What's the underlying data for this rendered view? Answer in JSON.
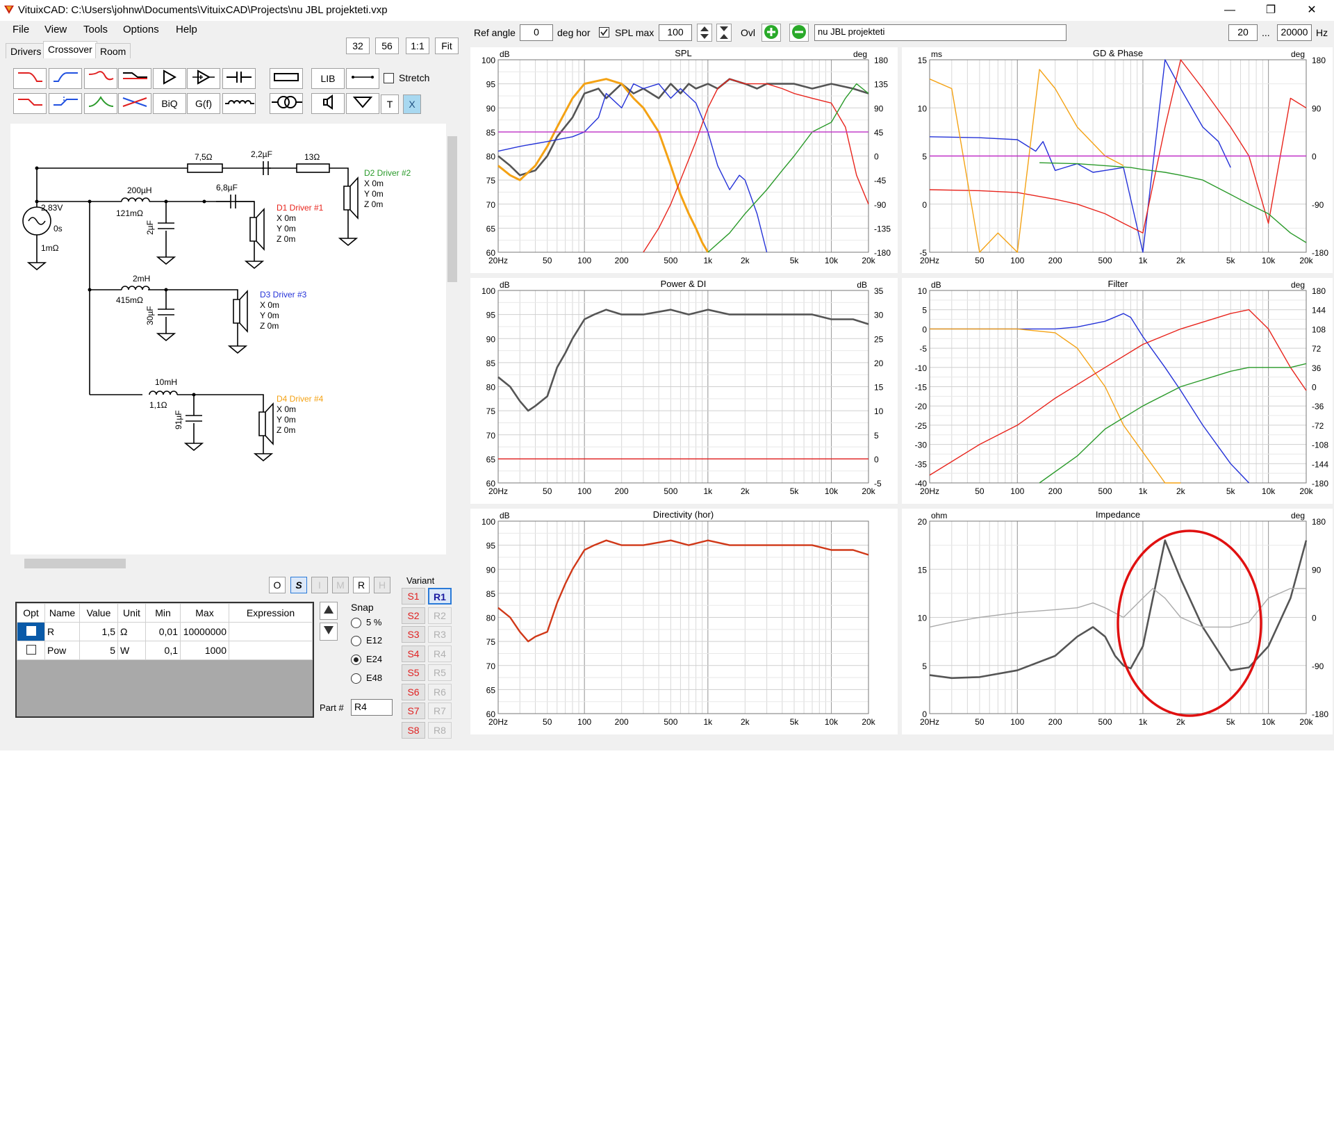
{
  "window": {
    "title": "VituixCAD: C:\\Users\\johnw\\Documents\\VituixCAD\\Projects\\nu JBL projekteti.vxp",
    "minimize": "—",
    "restore": "❐",
    "close": "✕"
  },
  "menu": [
    "File",
    "View",
    "Tools",
    "Options",
    "Help"
  ],
  "tabs": [
    "Drivers",
    "Crossover",
    "Room"
  ],
  "zoom": {
    "v1": "32",
    "v2": "56",
    "one": "1:1",
    "fit": "Fit"
  },
  "toolbar": {
    "lib": "LIB",
    "biq": "BiQ",
    "gf": "G(f)",
    "t": "T",
    "x": "X",
    "stretch": "Stretch"
  },
  "schematic": {
    "source_v": "2,83V",
    "source_phase": "0s",
    "source_r": "1mΩ",
    "r1": "7,5Ω",
    "c1": "2,2µF",
    "r2": "13Ω",
    "l1": "200µH",
    "l1r": "121mΩ",
    "c2": "6,8µF",
    "c3": "2µF",
    "l2": "2mH",
    "l2r": "415mΩ",
    "c4": "30µF",
    "l3": "10mH",
    "l3r": "1,1Ω",
    "c5": "91µF",
    "d1": "D1 Driver #1",
    "d2": "D2 Driver #2",
    "d3": "D3 Driver #3",
    "d4": "D4 Driver #4",
    "pos": [
      "X 0m",
      "Y 0m",
      "Z 0m"
    ],
    "colors": {
      "d1": "#e8241c",
      "d2": "#2a9a2a",
      "d3": "#2432d8",
      "d4": "#f4a214"
    }
  },
  "mode_buttons": [
    "O",
    "S",
    "I",
    "M",
    "R",
    "H"
  ],
  "params": {
    "headers": [
      "Opt",
      "Name",
      "Value",
      "Unit",
      "Min",
      "Max",
      "Expression"
    ],
    "rows": [
      [
        "",
        "R",
        "1,5",
        "Ω",
        "0,01",
        "10000000",
        ""
      ],
      [
        "",
        "Pow",
        "5",
        "W",
        "0,1",
        "1000",
        ""
      ]
    ]
  },
  "snap": {
    "label": "Snap",
    "options": [
      "5 %",
      "E12",
      "E24",
      "E48"
    ],
    "selected": "E24"
  },
  "part": {
    "label": "Part #",
    "value": "R4"
  },
  "variant": {
    "label": "Variant",
    "s": [
      "S1",
      "S2",
      "S3",
      "S4",
      "S5",
      "S6",
      "S7",
      "S8"
    ],
    "r": [
      "R1",
      "R2",
      "R3",
      "R4",
      "R5",
      "R6",
      "R7",
      "R8"
    ],
    "active": "R1"
  },
  "topbar": {
    "ref_angle_label": "Ref angle",
    "ref_angle_value": "0",
    "deg_hor": "deg hor",
    "spl_max_label": "SPL max",
    "spl_max_value": "100",
    "ovl": "Ovl",
    "project": "nu JBL projekteti",
    "freq_min": "20",
    "ellipsis": "...",
    "freq_max": "20000",
    "hz": "Hz"
  },
  "freq_ticks": [
    "20Hz",
    "50",
    "100",
    "200",
    "500",
    "1k",
    "2k",
    "5k",
    "10k",
    "20k"
  ],
  "chart_data": [
    {
      "type": "line",
      "title": "SPL",
      "ylabel_left": "dB",
      "ylabel_right": "deg",
      "ylim": [
        60,
        100
      ],
      "ylim_right": [
        -180,
        180
      ],
      "yticks_left": [
        "100",
        "95",
        "90",
        "85",
        "80",
        "75",
        "70",
        "65",
        "60"
      ],
      "yticks_right": [
        "180",
        "135",
        "90",
        "45",
        "0",
        "-45",
        "-90",
        "-135",
        "-180"
      ],
      "series": [
        {
          "color": "#555555",
          "x": [
            20,
            25,
            30,
            40,
            50,
            60,
            80,
            100,
            130,
            150,
            200,
            250,
            300,
            400,
            500,
            600,
            700,
            800,
            1000,
            1200,
            1500,
            2000,
            2500,
            3000,
            4000,
            5000,
            7000,
            10000,
            15000,
            20000
          ],
          "y": [
            80,
            78,
            76,
            77,
            80,
            84,
            88,
            93,
            94,
            92,
            95,
            93,
            94,
            92,
            95,
            93,
            95,
            94,
            95,
            94,
            96,
            95,
            94,
            95,
            95,
            95,
            94,
            95,
            94,
            93
          ]
        },
        {
          "color": "#f4a214",
          "x": [
            20,
            25,
            30,
            40,
            50,
            60,
            80,
            100,
            150,
            200,
            250,
            300,
            400,
            500,
            600,
            700,
            800,
            900,
            1000
          ],
          "y": [
            78,
            76,
            75,
            78,
            82,
            86,
            92,
            95,
            96,
            95,
            92,
            90,
            85,
            78,
            72,
            68,
            65,
            62,
            60
          ]
        },
        {
          "color": "#2432d8",
          "x": [
            20,
            30,
            50,
            80,
            100,
            130,
            150,
            200,
            250,
            300,
            400,
            500,
            600,
            800,
            1000,
            1200,
            1500,
            1800,
            2000,
            2500,
            3000
          ],
          "y": [
            81,
            82,
            83,
            84,
            85,
            88,
            93,
            90,
            95,
            94,
            95,
            92,
            94,
            91,
            85,
            78,
            73,
            76,
            75,
            68,
            60
          ]
        },
        {
          "color": "#e8241c",
          "x": [
            300,
            400,
            500,
            600,
            800,
            1000,
            1200,
            1500,
            2000,
            3000,
            4000,
            5000,
            7000,
            10000,
            13000,
            16000,
            20000
          ],
          "y": [
            60,
            65,
            70,
            75,
            83,
            90,
            94,
            96,
            95,
            95,
            94,
            93,
            92,
            91,
            86,
            76,
            70
          ]
        },
        {
          "color": "#2a9a2a",
          "x": [
            1000,
            1500,
            2000,
            3000,
            4000,
            5000,
            7000,
            10000,
            13000,
            16000,
            20000
          ],
          "y": [
            60,
            64,
            68,
            73,
            77,
            80,
            85,
            87,
            92,
            95,
            93
          ]
        },
        {
          "color": "#c030c8",
          "x": [
            20,
            20000
          ],
          "y": [
            85,
            85
          ]
        }
      ]
    },
    {
      "type": "line",
      "title": "GD & Phase",
      "ylabel_left": "ms",
      "ylabel_right": "deg",
      "ylim": [
        -5,
        15
      ],
      "ylim_right": [
        -180,
        180
      ],
      "yticks_left": [
        "15",
        "10",
        "5",
        "0",
        "-5"
      ],
      "yticks_right": [
        "180",
        "90",
        "0",
        "-90",
        "-180"
      ],
      "series": [
        {
          "color": "#2432d8",
          "x": [
            20,
            50,
            100,
            140,
            160,
            200,
            300,
            400,
            500,
            700,
            1000,
            1500,
            2000,
            3000,
            4000,
            5000
          ],
          "y": [
            7,
            6.9,
            6.7,
            5.5,
            6.5,
            3.5,
            4.2,
            3.3,
            3.5,
            3.8,
            -5,
            15,
            12,
            8,
            6.5,
            3.8
          ]
        },
        {
          "color": "#e8241c",
          "x": [
            20,
            50,
            100,
            200,
            300,
            500,
            700,
            1000,
            1500,
            2000,
            3000,
            5000,
            7000,
            10000,
            15000,
            20000
          ],
          "y": [
            1.5,
            1.4,
            1.2,
            0.5,
            0,
            -1,
            -2,
            -3,
            8,
            15,
            12,
            8,
            5,
            -2,
            11,
            10
          ]
        },
        {
          "color": "#2a9a2a",
          "x": [
            150,
            300,
            500,
            800,
            1000,
            1500,
            2000,
            3000,
            5000,
            7000,
            10000,
            15000,
            20000
          ],
          "y": [
            4.3,
            4.2,
            4,
            3.8,
            3.6,
            3.3,
            3,
            2.5,
            1,
            0,
            -1,
            -3,
            -4
          ]
        },
        {
          "color": "#f4a214",
          "x": [
            20,
            30,
            50,
            70,
            100,
            150,
            200,
            300,
            500,
            700
          ],
          "y": [
            13,
            12,
            -5,
            -3,
            -5,
            14,
            12,
            8,
            5,
            4
          ]
        },
        {
          "color": "#c030c8",
          "x": [
            20,
            20000
          ],
          "y": [
            5,
            5
          ]
        }
      ]
    },
    {
      "type": "line",
      "title": "Power & DI",
      "ylabel_left": "dB",
      "ylabel_right": "dB",
      "ylim": [
        60,
        100
      ],
      "ylim_right": [
        -5,
        35
      ],
      "yticks_left": [
        "100",
        "95",
        "90",
        "85",
        "80",
        "75",
        "70",
        "65",
        "60"
      ],
      "yticks_right": [
        "35",
        "30",
        "25",
        "20",
        "15",
        "10",
        "5",
        "0",
        "-5"
      ],
      "series": [
        {
          "color": "#555555",
          "x": [
            20,
            25,
            30,
            35,
            40,
            50,
            60,
            70,
            80,
            100,
            120,
            150,
            200,
            300,
            500,
            700,
            1000,
            1500,
            2000,
            3000,
            5000,
            7000,
            10000,
            15000,
            20000
          ],
          "y": [
            82,
            80,
            77,
            75,
            76,
            78,
            84,
            87,
            90,
            94,
            95,
            96,
            95,
            95,
            96,
            95,
            96,
            95,
            95,
            95,
            95,
            95,
            94,
            94,
            93
          ]
        },
        {
          "color": "#e01818",
          "x": [
            20,
            20000
          ],
          "y": [
            65,
            65
          ]
        }
      ]
    },
    {
      "type": "line",
      "title": "Filter",
      "ylabel_left": "dB",
      "ylabel_right": "deg",
      "ylim": [
        -40,
        10
      ],
      "ylim_right": [
        -180,
        180
      ],
      "yticks_left": [
        "10",
        "5",
        "0",
        "-5",
        "-10",
        "-15",
        "-20",
        "-25",
        "-30",
        "-35",
        "-40"
      ],
      "yticks_right": [
        "180",
        "144",
        "108",
        "72",
        "36",
        "0",
        "-36",
        "-72",
        "-108",
        "-144",
        "-180"
      ],
      "series": [
        {
          "color": "#2432d8",
          "x": [
            20,
            100,
            200,
            300,
            500,
            700,
            800,
            1000,
            1500,
            2000,
            3000,
            5000,
            7000
          ],
          "y": [
            0,
            0,
            0,
            0.5,
            2,
            4,
            3,
            -2,
            -10,
            -16,
            -25,
            -35,
            -40
          ]
        },
        {
          "color": "#f4a214",
          "x": [
            20,
            100,
            200,
            300,
            500,
            700,
            1000,
            1500,
            2000
          ],
          "y": [
            0,
            0,
            -1,
            -5,
            -15,
            -25,
            -32,
            -40,
            -40
          ]
        },
        {
          "color": "#e8241c",
          "x": [
            20,
            50,
            100,
            200,
            500,
            1000,
            2000,
            5000,
            7000,
            10000,
            15000,
            20000
          ],
          "y": [
            -38,
            -30,
            -25,
            -18,
            -10,
            -4,
            0,
            4,
            5,
            0,
            -10,
            -16
          ]
        },
        {
          "color": "#2a9a2a",
          "x": [
            150,
            300,
            500,
            1000,
            2000,
            5000,
            7000,
            10000,
            15000,
            20000
          ],
          "y": [
            -40,
            -33,
            -26,
            -20,
            -15,
            -11,
            -10,
            -10,
            -10,
            -9
          ]
        }
      ]
    },
    {
      "type": "line",
      "title": "Directivity (hor)",
      "ylabel_left": "dB",
      "ylim": [
        60,
        100
      ],
      "yticks_left": [
        "100",
        "95",
        "90",
        "85",
        "80",
        "75",
        "70",
        "65",
        "60"
      ],
      "series": [
        {
          "color": "#d03818",
          "x": [
            20,
            25,
            30,
            35,
            40,
            50,
            60,
            70,
            80,
            100,
            120,
            150,
            200,
            300,
            500,
            700,
            1000,
            1500,
            2000,
            3000,
            5000,
            7000,
            10000,
            15000,
            20000
          ],
          "y": [
            82,
            80,
            77,
            75,
            76,
            77,
            83,
            87,
            90,
            94,
            95,
            96,
            95,
            95,
            96,
            95,
            96,
            95,
            95,
            95,
            95,
            95,
            94,
            94,
            93
          ]
        }
      ]
    },
    {
      "type": "line",
      "title": "Impedance",
      "ylabel_left": "ohm",
      "ylabel_right": "deg",
      "ylim": [
        0,
        20
      ],
      "ylim_right": [
        -180,
        180
      ],
      "yticks_left": [
        "20",
        "15",
        "10",
        "5",
        "0"
      ],
      "yticks_right": [
        "180",
        "90",
        "0",
        "-90",
        "-180"
      ],
      "series": [
        {
          "color": "#555555",
          "x": [
            20,
            30,
            50,
            100,
            200,
            300,
            400,
            500,
            600,
            700,
            800,
            1000,
            1200,
            1500,
            2000,
            3000,
            5000,
            7000,
            10000,
            15000,
            20000
          ],
          "y": [
            4,
            3.7,
            3.8,
            4.5,
            6,
            8,
            9,
            8,
            6,
            5,
            4.7,
            7,
            12,
            18,
            14,
            9,
            4.5,
            4.8,
            7,
            12,
            18
          ]
        },
        {
          "color": "#aaaaaa",
          "x": [
            20,
            30,
            50,
            100,
            200,
            300,
            400,
            500,
            700,
            1000,
            1200,
            1500,
            2000,
            3000,
            5000,
            7000,
            10000,
            15000,
            20000
          ],
          "y": [
            9,
            9.5,
            10,
            10.5,
            10.8,
            11,
            11.5,
            11,
            10,
            12,
            13,
            12,
            10,
            9,
            9,
            9.5,
            12,
            13,
            13
          ]
        }
      ]
    }
  ],
  "colors": {
    "highlight_ellipse": "#e01010",
    "accent_blue": "#2a7ad8",
    "green_plus": "#2aaa2a"
  }
}
